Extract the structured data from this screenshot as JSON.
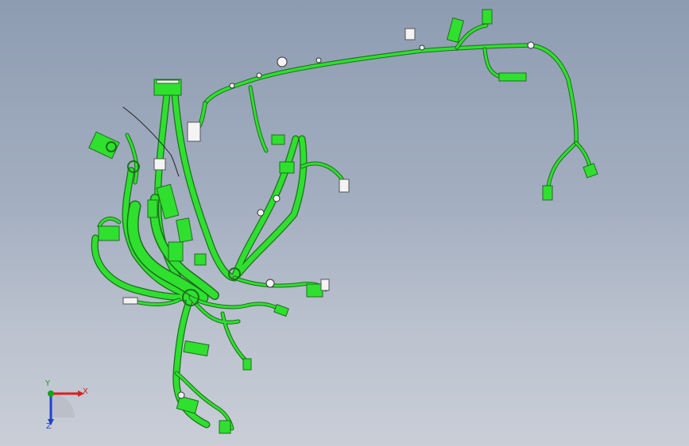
{
  "view": {
    "background_top": "#8e9cb2",
    "background_bottom": "#c9ced7",
    "model_color": "#2fe02f",
    "model_edge_color": "#1f6d1f",
    "connector_white": "#f4f4f4"
  },
  "model": {
    "description_icon": "wiring-harness-model"
  },
  "triad": {
    "x_label": "X",
    "y_label": "Y",
    "z_label": "Z",
    "x_color": "#d82020",
    "y_color": "#1aa01a",
    "z_color": "#2040d0"
  }
}
